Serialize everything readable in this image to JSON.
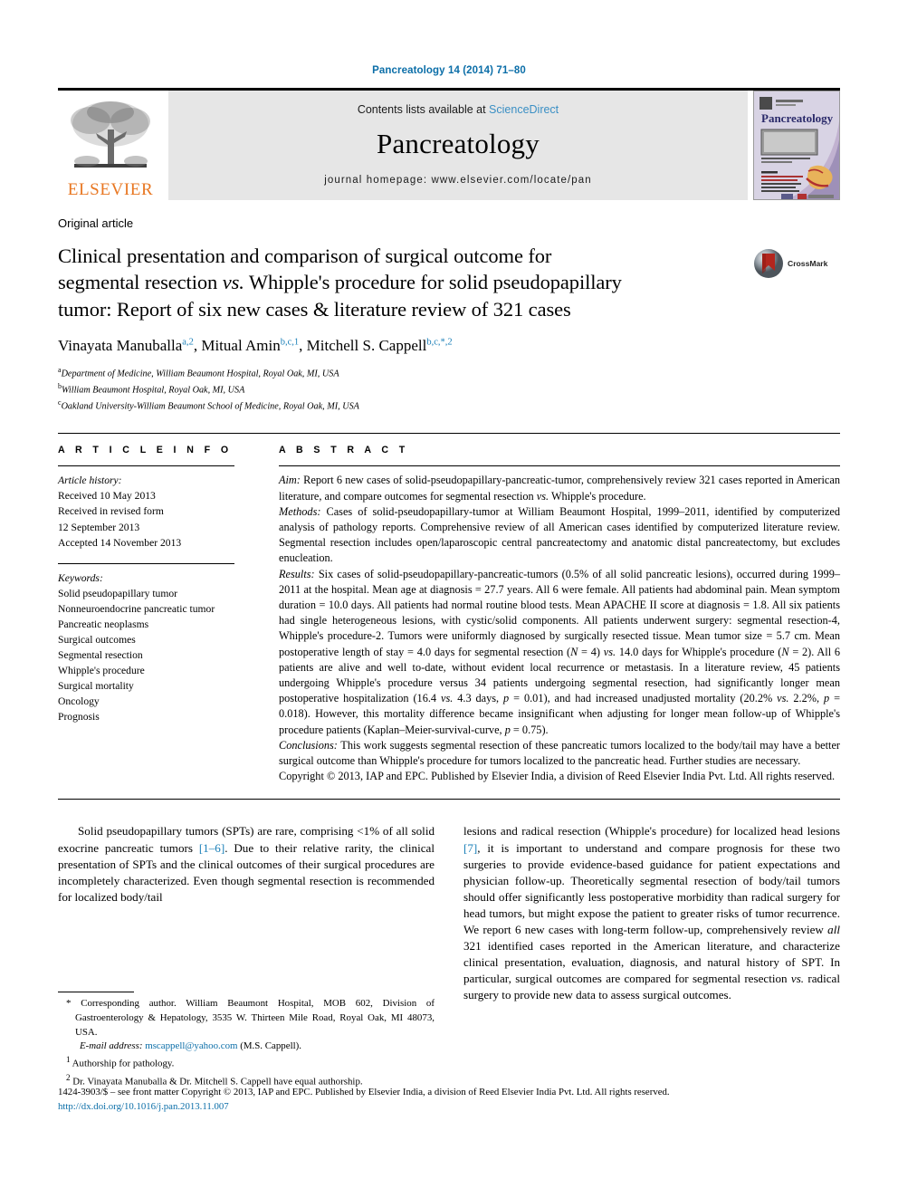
{
  "running_head": "Pancreatology 14 (2014) 71–80",
  "masthead": {
    "publisher_logo_label": "ELSEVIER",
    "contents_prefix": "Contents lists available at ",
    "contents_link": "ScienceDirect",
    "journal_title": "Pancreatology",
    "homepage_line": "journal homepage: www.elsevier.com/locate/pan",
    "cover_journal_name": "Pancreatology"
  },
  "article_type": "Original article",
  "title": {
    "line1_a": "Clinical presentation and comparison of surgical outcome for",
    "line2_a": "segmental resection ",
    "line2_i": "vs.",
    "line2_b": " Whipple's procedure for solid pseudopapillary",
    "line3_a": "tumor: Report of six new cases & literature review of 321 cases"
  },
  "crossmark": {
    "label": "CrossMark"
  },
  "authors": [
    {
      "name": "Vinayata Manuballa",
      "sup": "a,2",
      "sep": ", "
    },
    {
      "name": "Mitual Amin",
      "sup": "b,c,1",
      "sep": ", "
    },
    {
      "name": "Mitchell S. Cappell",
      "sup": "b,c,*,2",
      "sep": ""
    }
  ],
  "affiliations": [
    {
      "mark": "a",
      "text": "Department of Medicine, William Beaumont Hospital, Royal Oak, MI, USA"
    },
    {
      "mark": "b",
      "text": "William Beaumont Hospital, Royal Oak, MI, USA"
    },
    {
      "mark": "c",
      "text": "Oakland University-William Beaumont School of Medicine, Royal Oak, MI, USA"
    }
  ],
  "article_info": {
    "heading": "A R T I C L E  I N F O",
    "history_label": "Article history:",
    "history": [
      "Received 10 May 2013",
      "Received in revised form",
      "12 September 2013",
      "Accepted 14 November 2013"
    ],
    "keywords_label": "Keywords:",
    "keywords": [
      "Solid pseudopapillary tumor",
      "Nonneuroendocrine pancreatic tumor",
      "Pancreatic neoplasms",
      "Surgical outcomes",
      "Segmental resection",
      "Whipple's procedure",
      "Surgical mortality",
      "Oncology",
      "Prognosis"
    ]
  },
  "abstract": {
    "heading": "A B S T R A C T",
    "aim_label": "Aim:",
    "aim_text": " Report 6 new cases of solid-pseudopapillary-pancreatic-tumor, comprehensively review 321 cases reported in American literature, and compare outcomes for segmental resection vs. Whipple's procedure.",
    "methods_label": "Methods:",
    "methods_text": " Cases of solid-pseudopapillary-tumor at William Beaumont Hospital, 1999–2011, identified by computerized analysis of pathology reports. Comprehensive review of all American cases identified by computerized literature review. Segmental resection includes open/laparoscopic central pancreatectomy and anatomic distal pancreatectomy, but excludes enucleation.",
    "results_label": "Results:",
    "results_text": " Six cases of solid-pseudopapillary-pancreatic-tumors (0.5% of all solid pancreatic lesions), occurred during 1999–2011 at the hospital. Mean age at diagnosis = 27.7 years. All 6 were female. All patients had abdominal pain. Mean symptom duration = 10.0 days. All patients had normal routine blood tests. Mean APACHE II score at diagnosis = 1.8. All six patients had single heterogeneous lesions, with cystic/solid components. All patients underwent surgery: segmental resection-4, Whipple's procedure-2. Tumors were uniformly diagnosed by surgically resected tissue. Mean tumor size = 5.7 cm. Mean postoperative length of stay = 4.0 days for segmental resection (N = 4) vs. 14.0 days for Whipple's procedure (N = 2). All 6 patients are alive and well to-date, without evident local recurrence or metastasis. In a literature review, 45 patients undergoing Whipple's procedure versus 34 patients undergoing segmental resection, had significantly longer mean postoperative hospitalization (16.4 vs. 4.3 days, p = 0.01), and had increased unadjusted mortality (20.2% vs. 2.2%, p = 0.018). However, this mortality difference became insignificant when adjusting for longer mean follow-up of Whipple's procedure patients (Kaplan–Meier-survival-curve, p = 0.75).",
    "conclusions_label": "Conclusions:",
    "conclusions_text": " This work suggests segmental resection of these pancreatic tumors localized to the body/tail may have a better surgical outcome than Whipple's procedure for tumors localized to the pancreatic head. Further studies are necessary.",
    "copyright": "Copyright © 2013, IAP and EPC. Published by Elsevier India, a division of Reed Elsevier India Pvt. Ltd. All rights reserved."
  },
  "body": {
    "left_para_1": "Solid pseudopapillary tumors (SPTs) are rare, comprising <1% of all solid exocrine pancreatic tumors [1–6]. Due to their relative rarity, the clinical presentation of SPTs and the clinical outcomes of their surgical procedures are incompletely characterized. Even though segmental resection is recommended for localized body/tail",
    "left_ref": "[1–6]",
    "right_para_1": "lesions and radical resection (Whipple's procedure) for localized head lesions [7], it is important to understand and compare prognosis for these two surgeries to provide evidence-based guidance for patient expectations and physician follow-up. Theoretically segmental resection of body/tail tumors should offer significantly less postoperative morbidity than radical surgery for head tumors, but might expose the patient to greater risks of tumor recurrence. We report 6 new cases with long-term follow-up, comprehensively review all 321 identified cases reported in the American literature, and characterize clinical presentation, evaluation, diagnosis, and natural history of SPT. In particular, surgical outcomes are compared for segmental resection vs. radical surgery to provide new data to assess surgical outcomes.",
    "right_ref": "[7]"
  },
  "footnotes": {
    "corresponding": "* Corresponding author. William Beaumont Hospital, MOB 602, Division of Gastroenterology & Hepatology, 3535 W. Thirteen Mile Road, Royal Oak, MI 48073, USA.",
    "email_label": "E-mail address:",
    "email": "mscappell@yahoo.com",
    "email_suffix": " (M.S. Cappell).",
    "note1_mark": "1",
    "note1": "Authorship for pathology.",
    "note2_mark": "2",
    "note2": "Dr. Vinayata Manuballa & Dr. Mitchell S. Cappell have equal authorship."
  },
  "page_footer": {
    "issn_line": "1424-3903/$ – see front matter Copyright © 2013, IAP and EPC. Published by Elsevier India, a division of Reed Elsevier India Pvt. Ltd. All rights reserved.",
    "doi": "http://dx.doi.org/10.1016/j.pan.2013.11.007"
  },
  "colors": {
    "link_blue": "#0b6ea8",
    "sciencedirect_blue": "#3a8fc4",
    "elsevier_orange": "#E87722",
    "reference_blue": "#1a7fb8",
    "masthead_gray": "#e6e6e6"
  }
}
